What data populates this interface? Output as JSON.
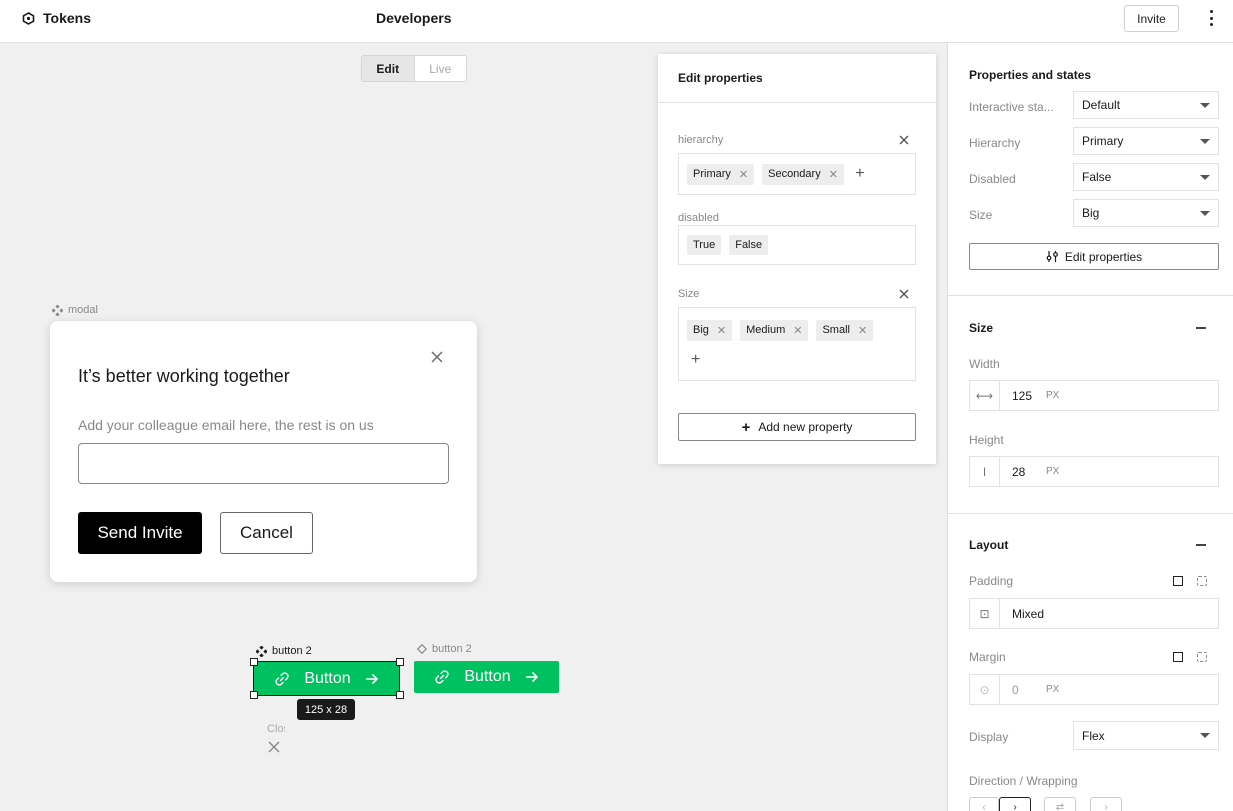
{
  "topbar": {
    "brand": "Tokens",
    "page_name": "Developers",
    "invite_label": "Invite"
  },
  "mode_toggle": {
    "edit": "Edit",
    "live": "Live",
    "selected": "Edit"
  },
  "canvas": {
    "modal_label": "modal",
    "modal": {
      "title": "It’s better working together",
      "field_label": "Add your colleague email here, the rest is on us",
      "input_value": "",
      "send_label": "Send Invite",
      "cancel_label": "Cancel",
      "close_icon": "close-icon"
    },
    "button1_label": "button 2",
    "button2_label": "button 2",
    "button_text": "Button",
    "size_tooltip": "125 x 28",
    "close_label": "Close",
    "accent_color": "#00c160"
  },
  "edit_properties": {
    "title": "Edit properties",
    "properties": [
      {
        "name": "hierarchy",
        "values": [
          "Primary",
          "Secondary"
        ],
        "removable": true
      },
      {
        "name": "disabled",
        "values": [
          "True",
          "False"
        ],
        "removable": false
      },
      {
        "name": "Size",
        "values": [
          "Big",
          "Medium",
          "Small"
        ],
        "removable": true
      }
    ],
    "add_label": "Add new property"
  },
  "right_panel": {
    "props_title": "Properties and states",
    "props": [
      {
        "label": "Interactive sta...",
        "value": "Default"
      },
      {
        "label": "Hierarchy",
        "value": "Primary"
      },
      {
        "label": "Disabled",
        "value": "False"
      },
      {
        "label": "Size",
        "value": "Big"
      }
    ],
    "edit_props_label": "Edit properties",
    "size_title": "Size",
    "width_label": "Width",
    "width_value": "125",
    "height_label": "Height",
    "height_value": "28",
    "unit": "PX",
    "layout_title": "Layout",
    "padding_label": "Padding",
    "padding_value": "Mixed",
    "margin_label": "Margin",
    "margin_value": "0",
    "display_label": "Display",
    "display_value": "Flex",
    "direction_label": "Direction / Wrapping"
  }
}
